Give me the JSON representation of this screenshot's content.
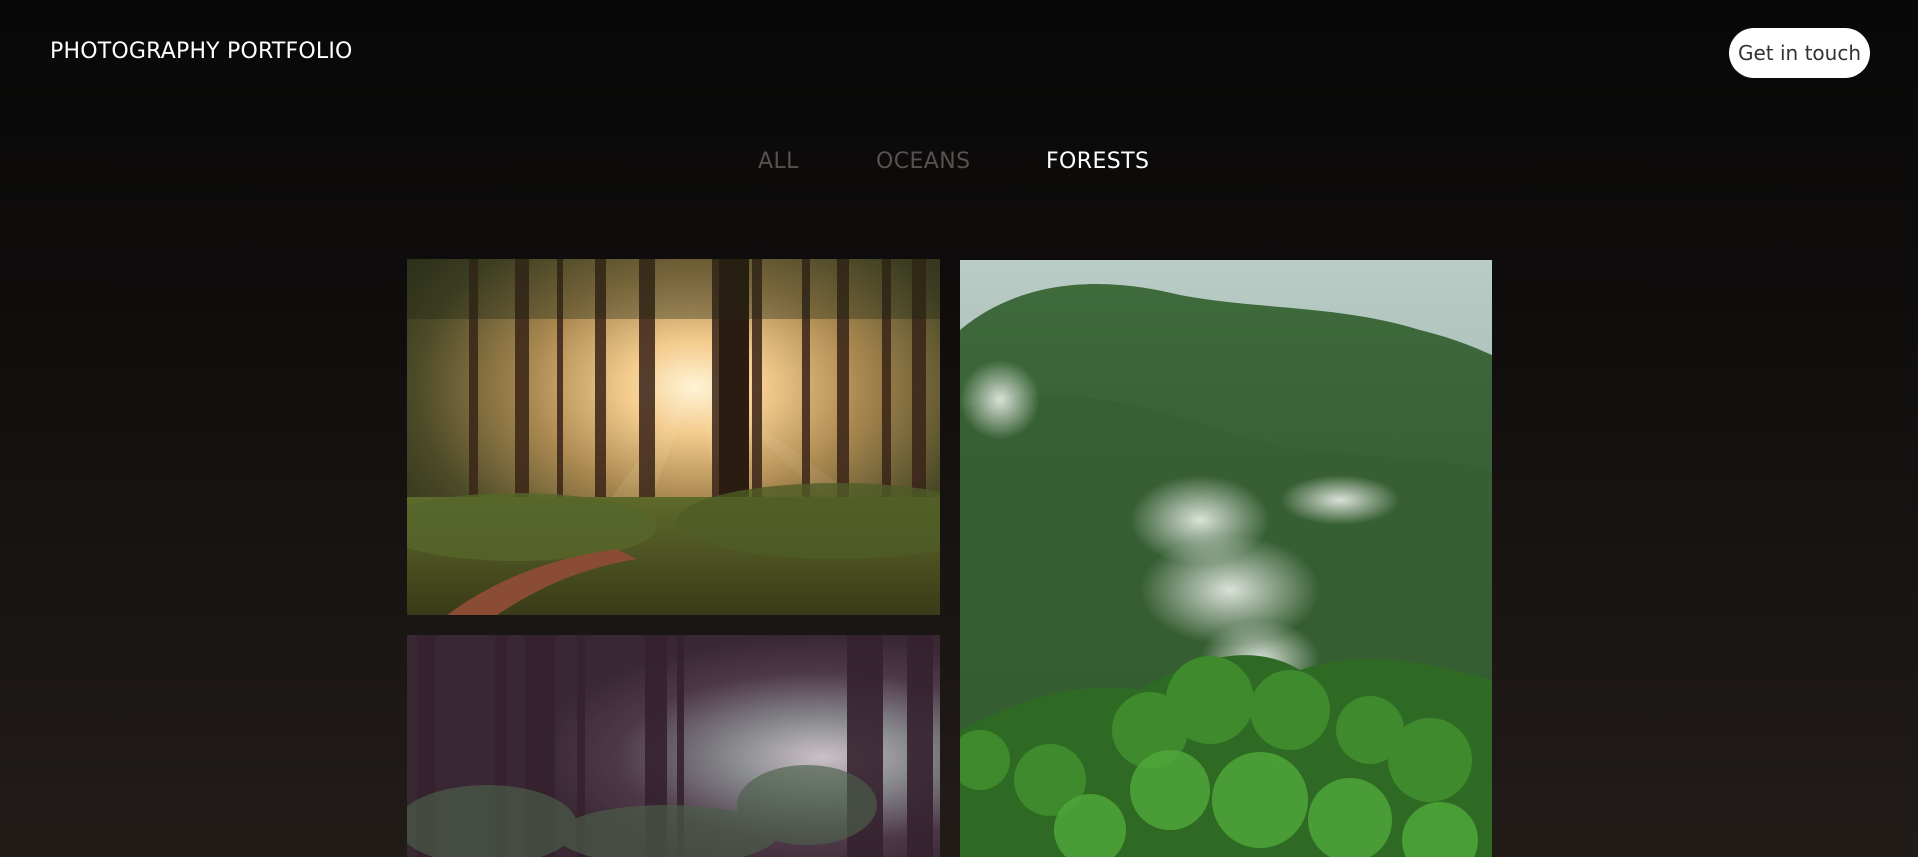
{
  "header": {
    "logo": "PHOTOGRAPHY PORTFOLIO",
    "cta_label": "Get in touch"
  },
  "filters": {
    "items": [
      "ALL",
      "OCEANS",
      "FORESTS"
    ],
    "active": "FORESTS"
  },
  "colors": {
    "active_filter": "#ffffff",
    "inactive_filter": "#555250",
    "cta_background": "#ffffff",
    "cta_text": "#333333"
  },
  "gallery": [
    {
      "subject": "sunlit-forest-path"
    },
    {
      "subject": "misty-purple-forest"
    },
    {
      "subject": "foggy-green-hills"
    }
  ]
}
